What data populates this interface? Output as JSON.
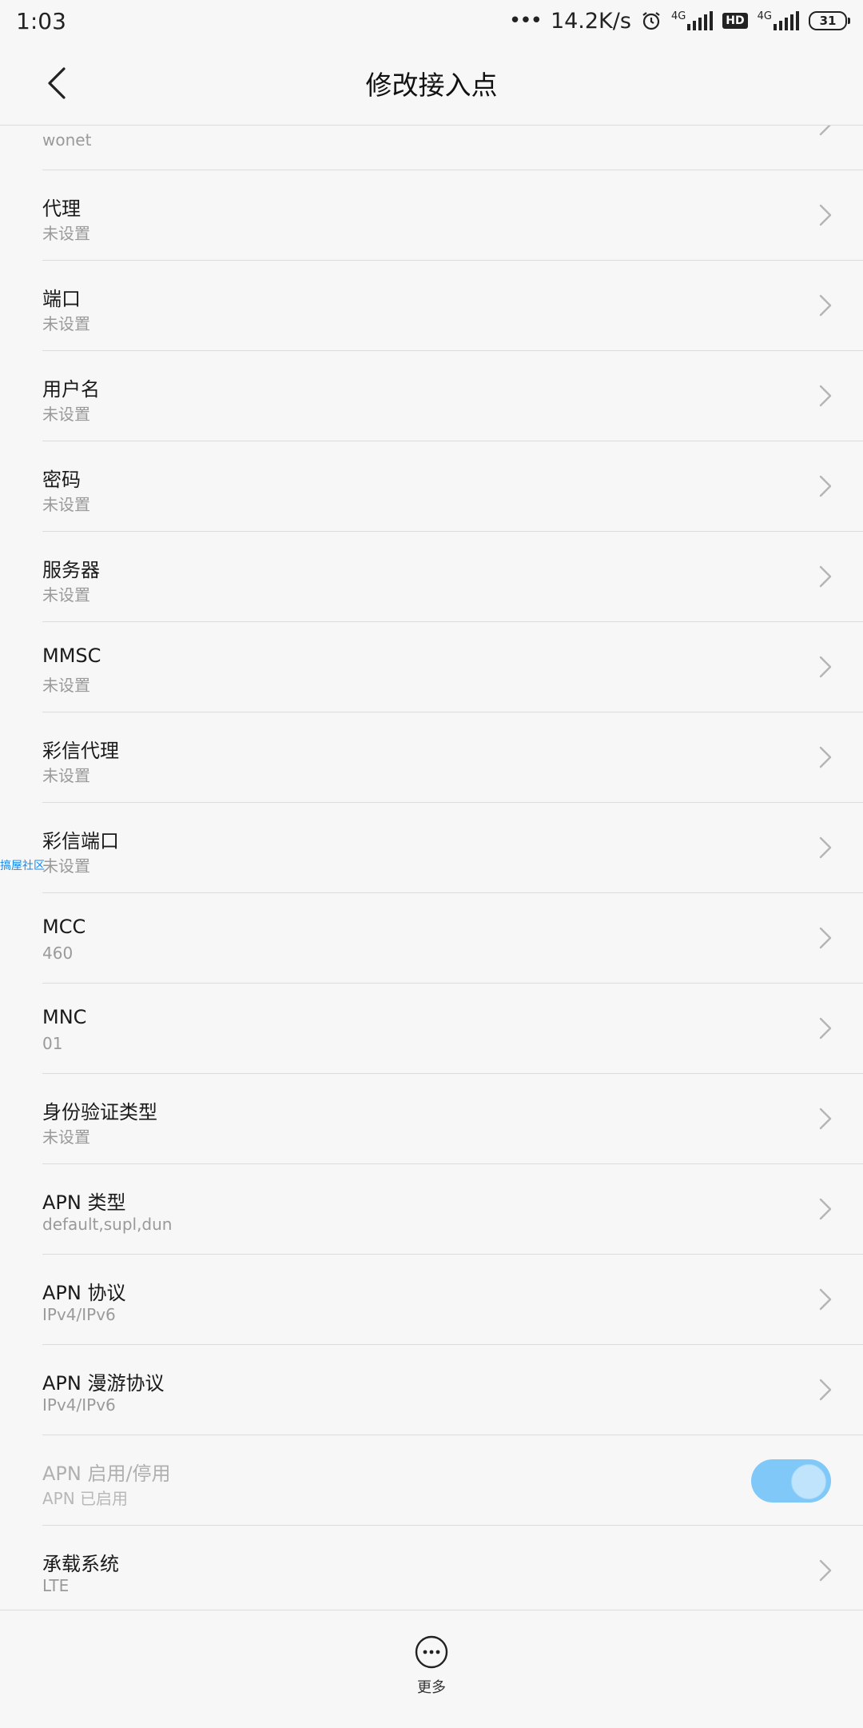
{
  "status_bar": {
    "time": "1:03",
    "net_speed": "14.2K/s",
    "net_type_1": "4G",
    "hd_badge": "HD",
    "net_type_2": "4G",
    "battery": "31",
    "icons": [
      "alarm-icon",
      "signal-icon",
      "hd-icon",
      "signal-icon",
      "battery-icon"
    ]
  },
  "header": {
    "title": "修改接入点"
  },
  "list": {
    "items": [
      {
        "title": "",
        "value": "wonet"
      },
      {
        "title": "代理",
        "value": "未设置"
      },
      {
        "title": "端口",
        "value": "未设置"
      },
      {
        "title": "用户名",
        "value": "未设置"
      },
      {
        "title": "密码",
        "value": "未设置"
      },
      {
        "title": "服务器",
        "value": "未设置"
      },
      {
        "title": "MMSC",
        "value": "未设置"
      },
      {
        "title": "彩信代理",
        "value": "未设置"
      },
      {
        "title": "彩信端口",
        "value": "未设置"
      },
      {
        "title": "MCC",
        "value": "460"
      },
      {
        "title": "MNC",
        "value": "01"
      },
      {
        "title": "身份验证类型",
        "value": "未设置"
      },
      {
        "title": "APN 类型",
        "value": "default,supl,dun"
      },
      {
        "title": "APN 协议",
        "value": "IPv4/IPv6"
      },
      {
        "title": "APN 漫游协议",
        "value": "IPv4/IPv6"
      },
      {
        "title": "APN 启用/停用",
        "value": "APN 已启用",
        "toggle_on": true
      },
      {
        "title": "承载系统",
        "value": "LTE"
      }
    ]
  },
  "watermark": "搞屋社区",
  "bottom_bar": {
    "more_label": "更多"
  },
  "colors": {
    "toggle_track": "#7fc8f8",
    "background": "#f7f7f7",
    "divider": "#dcdcdc"
  }
}
